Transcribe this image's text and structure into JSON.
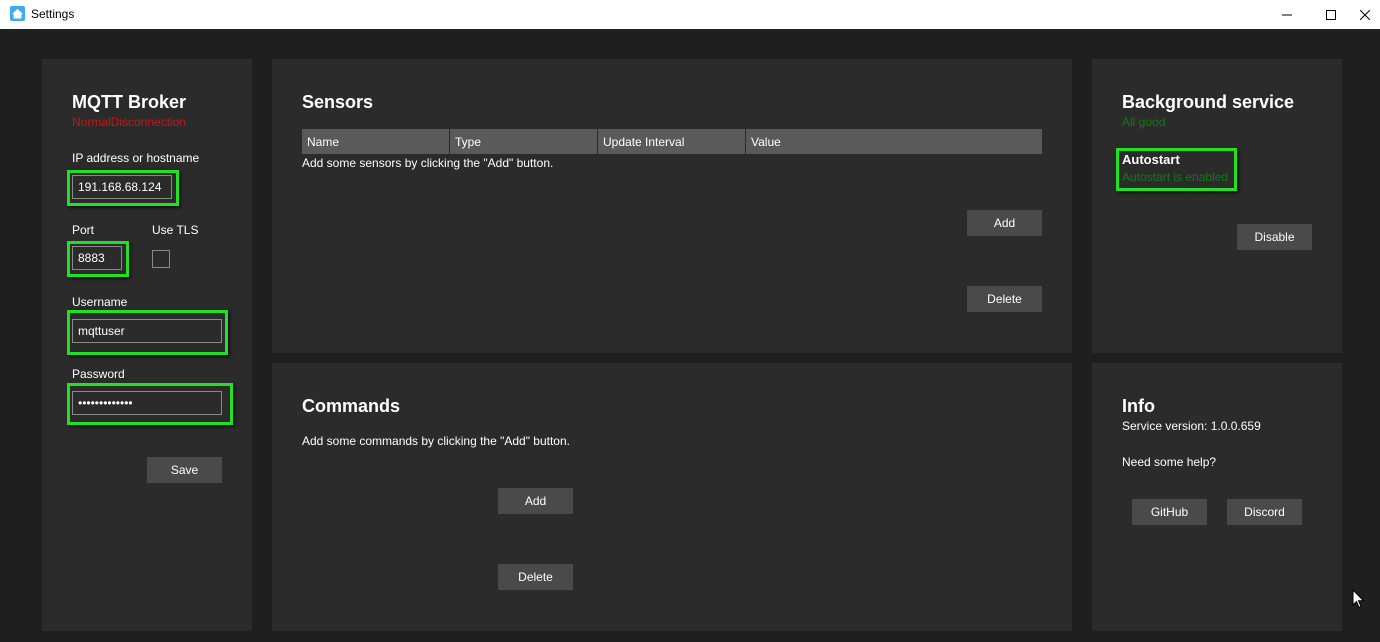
{
  "window": {
    "title": "Settings",
    "minimize_glyph": "—",
    "maximize_glyph": "☐",
    "close_glyph": "✕",
    "icon": "house-icon"
  },
  "mqtt": {
    "heading": "MQTT Broker",
    "status": "NormalDisconnection",
    "status_color": "#c51616",
    "host_label": "IP address or hostname",
    "host_value": "191.168.68.124",
    "port_label": "Port",
    "port_value": "8883",
    "tls_label": "Use TLS",
    "tls_checked": false,
    "username_label": "Username",
    "username_value": "mqttuser",
    "password_label": "Password",
    "password_value": "•••••••••••••",
    "save_label": "Save"
  },
  "sensors": {
    "heading": "Sensors",
    "columns": [
      "Name",
      "Type",
      "Update Interval",
      "Value"
    ],
    "empty_message": "Add some sensors by clicking the \"Add\" button.",
    "add_label": "Add",
    "delete_label": "Delete"
  },
  "background": {
    "heading": "Background service",
    "status": "All good",
    "status_color": "#137a13",
    "autostart_label": "Autostart",
    "autostart_status": "Autostart is enabled",
    "disable_label": "Disable"
  },
  "commands": {
    "heading": "Commands",
    "empty_message": "Add some commands by clicking the \"Add\" button.",
    "add_label": "Add",
    "delete_label": "Delete"
  },
  "info": {
    "heading": "Info",
    "version": "Service version: 1.0.0.659",
    "help": "Need some help?",
    "github_label": "GitHub",
    "discord_label": "Discord"
  },
  "colors": {
    "highlight": "#22e022",
    "panel": "#2b2b2b",
    "background": "#1f1f1f"
  }
}
